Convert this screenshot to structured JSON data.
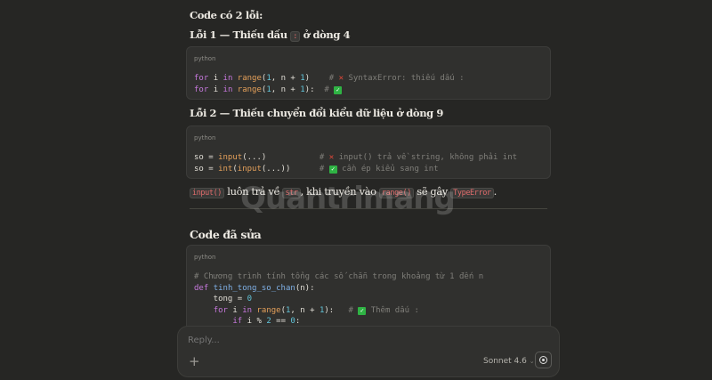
{
  "intro": "Code có 2 lỗi:",
  "error1": {
    "title_pre": "Lỗi 1 — Thiếu dấu",
    "title_code": ":",
    "title_post": "ở dòng 4",
    "lang": "python",
    "lines": [
      [
        [
          "kw",
          "for"
        ],
        [
          "",
          "i "
        ],
        [
          "kw",
          "in"
        ],
        [
          "",
          ""
        ],
        [
          "fn",
          "range"
        ],
        [
          "",
          "("
        ],
        [
          "num",
          "1"
        ],
        [
          "",
          ", n + "
        ],
        [
          "num",
          "1"
        ],
        [
          "",
          ")    "
        ],
        [
          "cm",
          "# "
        ],
        [
          "x",
          "✕"
        ],
        [
          "cm",
          " SyntaxError: thiếu dấu :"
        ]
      ],
      [
        [
          "kw",
          "for"
        ],
        [
          "",
          "i "
        ],
        [
          "kw",
          "in"
        ],
        [
          "",
          ""
        ],
        [
          "fn",
          "range"
        ],
        [
          "",
          "("
        ],
        [
          "num",
          "1"
        ],
        [
          "",
          ", n + "
        ],
        [
          "num",
          "1"
        ],
        [
          "",
          "):  "
        ],
        [
          "cm",
          "# "
        ],
        [
          "ok",
          "✓"
        ]
      ]
    ]
  },
  "error2": {
    "title": "Lỗi 2 — Thiếu chuyển đổi kiểu dữ liệu ở dòng 9",
    "lang": "python",
    "lines": [
      [
        [
          "",
          "so = "
        ],
        [
          "fn",
          "input"
        ],
        [
          "",
          "(...)           "
        ],
        [
          "cm",
          "# "
        ],
        [
          "x",
          "✕"
        ],
        [
          "cm",
          " input() trả về string, không phải int"
        ]
      ],
      [
        [
          "",
          "so = "
        ],
        [
          "fn",
          "int"
        ],
        [
          "",
          "("
        ],
        [
          "fn",
          "input"
        ],
        [
          "",
          "(...))      "
        ],
        [
          "cm",
          "# "
        ],
        [
          "ok",
          "✓"
        ],
        [
          "cm",
          " cần ép kiểu sang int"
        ]
      ]
    ]
  },
  "note": {
    "c1": "input()",
    "t1": "luôn trả về",
    "c2": "str",
    "t2": ", khi truyền vào",
    "c3": "range()",
    "t3": "sẽ gây",
    "c4": "TypeError",
    "t4": "."
  },
  "fixed": {
    "title": "Code đã sửa",
    "lang": "python",
    "lines": [
      [
        [
          "cm",
          "# Chương trình tính tổng các số chẵn trong khoảng từ 1 đến n"
        ]
      ],
      [
        [
          "kw",
          "def"
        ],
        [
          "",
          ""
        ],
        [
          "def",
          "tinh_tong_so_chan"
        ],
        [
          "",
          "(n):"
        ]
      ],
      [
        [
          "",
          "    tong = "
        ],
        [
          "num",
          "0"
        ]
      ],
      [
        [
          "",
          "    "
        ],
        [
          "kw",
          "for"
        ],
        [
          "",
          "i "
        ],
        [
          "kw",
          "in"
        ],
        [
          "",
          ""
        ],
        [
          "fn",
          "range"
        ],
        [
          "",
          "("
        ],
        [
          "num",
          "1"
        ],
        [
          "",
          ", n + "
        ],
        [
          "num",
          "1"
        ],
        [
          "",
          "):   "
        ],
        [
          "cm",
          "# "
        ],
        [
          "ok",
          "✓"
        ],
        [
          "cm",
          " Thêm dấu :"
        ]
      ],
      [
        [
          "",
          "        "
        ],
        [
          "kw",
          "if"
        ],
        [
          "",
          "i % "
        ],
        [
          "num",
          "2"
        ],
        [
          "",
          " == "
        ],
        [
          "num",
          "0"
        ],
        [
          "",
          ":"
        ]
      ]
    ]
  },
  "reply": {
    "placeholder": "Reply...",
    "model": "Sonnet 4.6"
  },
  "watermark": "Quantrimang"
}
